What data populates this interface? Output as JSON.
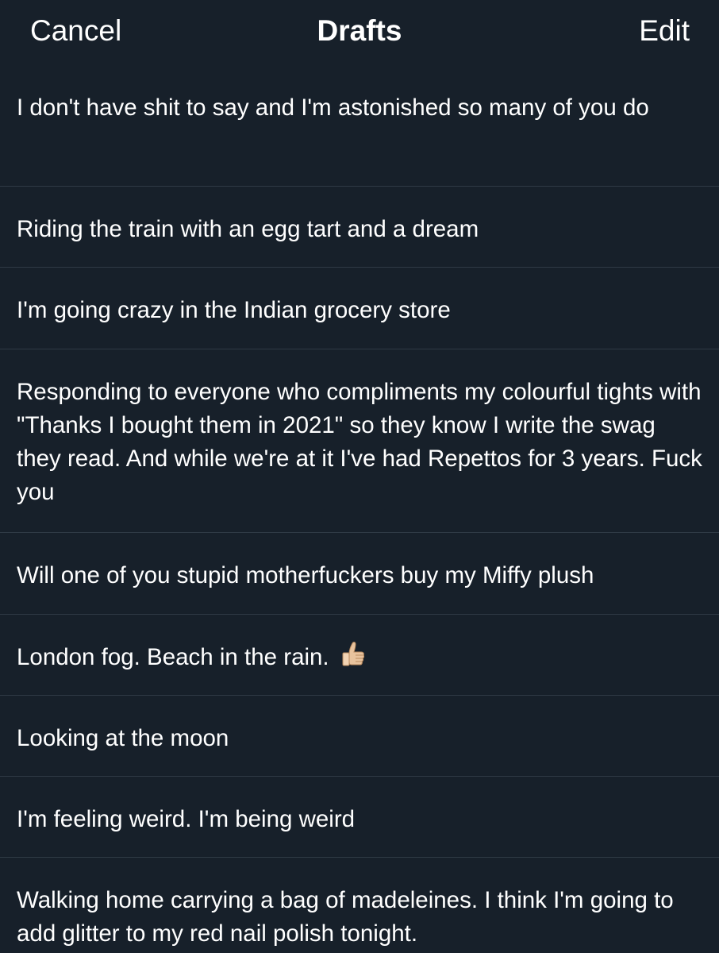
{
  "header": {
    "cancel_label": "Cancel",
    "title": "Drafts",
    "edit_label": "Edit"
  },
  "drafts": [
    {
      "text": "I don't have shit to say and I'm astonished so many of you do"
    },
    {
      "text": "Riding the train with an egg tart and a dream"
    },
    {
      "text": "I'm going crazy in the Indian grocery store"
    },
    {
      "text": "Responding to everyone who compliments my colourful tights with \"Thanks I bought them in 2021\" so they know I write the swag they read. And while we're at it I've had Repettos for 3 years. Fuck you"
    },
    {
      "text": "Will one of you stupid motherfuckers buy my Miffy plush"
    },
    {
      "text": "London fog. Beach in the rain.",
      "icon": "thumbs-up-emoji"
    },
    {
      "text": "Looking at the moon"
    },
    {
      "text": "I'm feeling weird. I'm being weird"
    },
    {
      "text": "Walking home carrying a bag of madeleines. I think I'm going to add glitter to my red nail polish tonight."
    }
  ],
  "colors": {
    "background": "#17202a",
    "divider": "#2f3a45",
    "text": "#ffffff"
  }
}
